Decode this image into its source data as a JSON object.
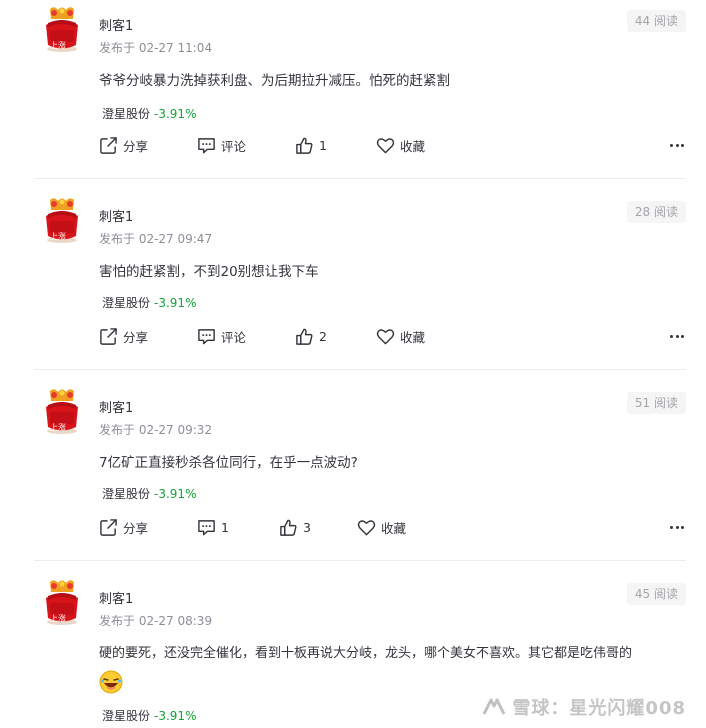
{
  "posts": [
    {
      "username": "刺客1",
      "avatar_badge": "上涨",
      "meta": "发布于 02-27 11:04",
      "views": "44 阅读",
      "content": "爷爷分岐暴力洗掉获利盘、为后期拉升减压。怕死的赶紧割",
      "stock_name": "澄星股份",
      "stock_change": "-3.91%",
      "share_label": "分享",
      "comment_label": "评论",
      "like_count": "1",
      "collect_label": "收藏"
    },
    {
      "username": "刺客1",
      "avatar_badge": "上涨",
      "meta": "发布于 02-27 09:47",
      "views": "28 阅读",
      "content": "害怕的赶紧割，不到20别想让我下车",
      "stock_name": "澄星股份",
      "stock_change": "-3.91%",
      "share_label": "分享",
      "comment_label": "评论",
      "like_count": "2",
      "collect_label": "收藏"
    },
    {
      "username": "刺客1",
      "avatar_badge": "上涨",
      "meta": "发布于 02-27 09:32",
      "views": "51 阅读",
      "content": "7亿矿正直接秒杀各位同行，在乎一点波动?",
      "stock_name": "澄星股份",
      "stock_change": "-3.91%",
      "share_label": "分享",
      "comment_label": "1",
      "like_count": "3",
      "collect_label": "收藏"
    },
    {
      "username": "刺客1",
      "avatar_badge": "上涨",
      "meta": "发布于 02-27 08:39",
      "views": "45 阅读",
      "content": "硬的要死，还没完全催化，看到十板再说大分岐，龙头，哪个美女不喜欢。其它都是吃伟哥的",
      "emoji": "laughing-face",
      "stock_name": "澄星股份",
      "stock_change": "-3.91%"
    }
  ],
  "watermark": "雪球：星光闪耀008",
  "colors": {
    "stock_down": "#13a338",
    "avatar_red": "#d8141b",
    "divider": "#ececec"
  },
  "icons": [
    "share-icon",
    "comment-icon",
    "like-icon",
    "collect-heart-icon",
    "more-dots-icon"
  ]
}
